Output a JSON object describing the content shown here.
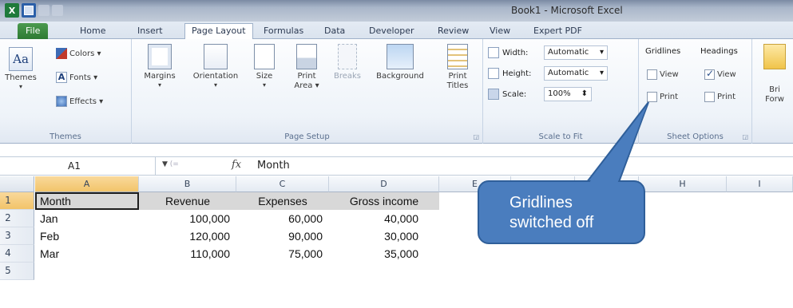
{
  "window": {
    "title": "Book1 - Microsoft Excel",
    "qat_logo": "X"
  },
  "tabs": [
    "File",
    "Home",
    "Insert",
    "Page Layout",
    "Formulas",
    "Data",
    "Developer",
    "Review",
    "View",
    "Expert PDF"
  ],
  "ribbon": {
    "themes": {
      "themes_label": "Themes",
      "colors_label": "Colors ▾",
      "fonts_label": "Fonts ▾",
      "effects_label": "Effects ▾",
      "group_label": "Themes"
    },
    "page_setup": {
      "margins": "Margins",
      "orientation": "Orientation",
      "size": "Size",
      "print_area_1": "Print",
      "print_area_2": "Area ▾",
      "breaks": "Breaks",
      "background": "Background",
      "print_titles_1": "Print",
      "print_titles_2": "Titles",
      "group_label": "Page Setup"
    },
    "scale_to_fit": {
      "width_label": "Width:",
      "width_value": "Automatic",
      "height_label": "Height:",
      "height_value": "Automatic",
      "scale_label": "Scale:",
      "scale_value": "100%",
      "group_label": "Scale to Fit"
    },
    "sheet_options": {
      "gridlines_header": "Gridlines",
      "headings_header": "Headings",
      "view_label": "View",
      "print_label": "Print",
      "gridlines_view": false,
      "gridlines_print": false,
      "headings_view": true,
      "headings_print": false,
      "group_label": "Sheet Options"
    },
    "arrange": {
      "bring_forward_1": "Bri",
      "bring_forward_2": "Forw"
    }
  },
  "formula_bar": {
    "name_box": "A1",
    "fx_label": "fx",
    "content": "Month"
  },
  "columns": [
    "A",
    "B",
    "C",
    "D",
    "E",
    "F",
    "G",
    "H",
    "I"
  ],
  "rows": [
    "1",
    "2",
    "3",
    "4",
    "5"
  ],
  "table": {
    "headers": [
      "Month",
      "Revenue",
      "Expenses",
      "Gross income"
    ],
    "data": [
      [
        "Jan",
        "100,000",
        "60,000",
        "40,000"
      ],
      [
        "Feb",
        "120,000",
        "90,000",
        "30,000"
      ],
      [
        "Mar",
        "110,000",
        "75,000",
        "35,000"
      ]
    ]
  },
  "callout": {
    "line1": "Gridlines",
    "line2": "switched off",
    "color": "#4a7dbe"
  }
}
